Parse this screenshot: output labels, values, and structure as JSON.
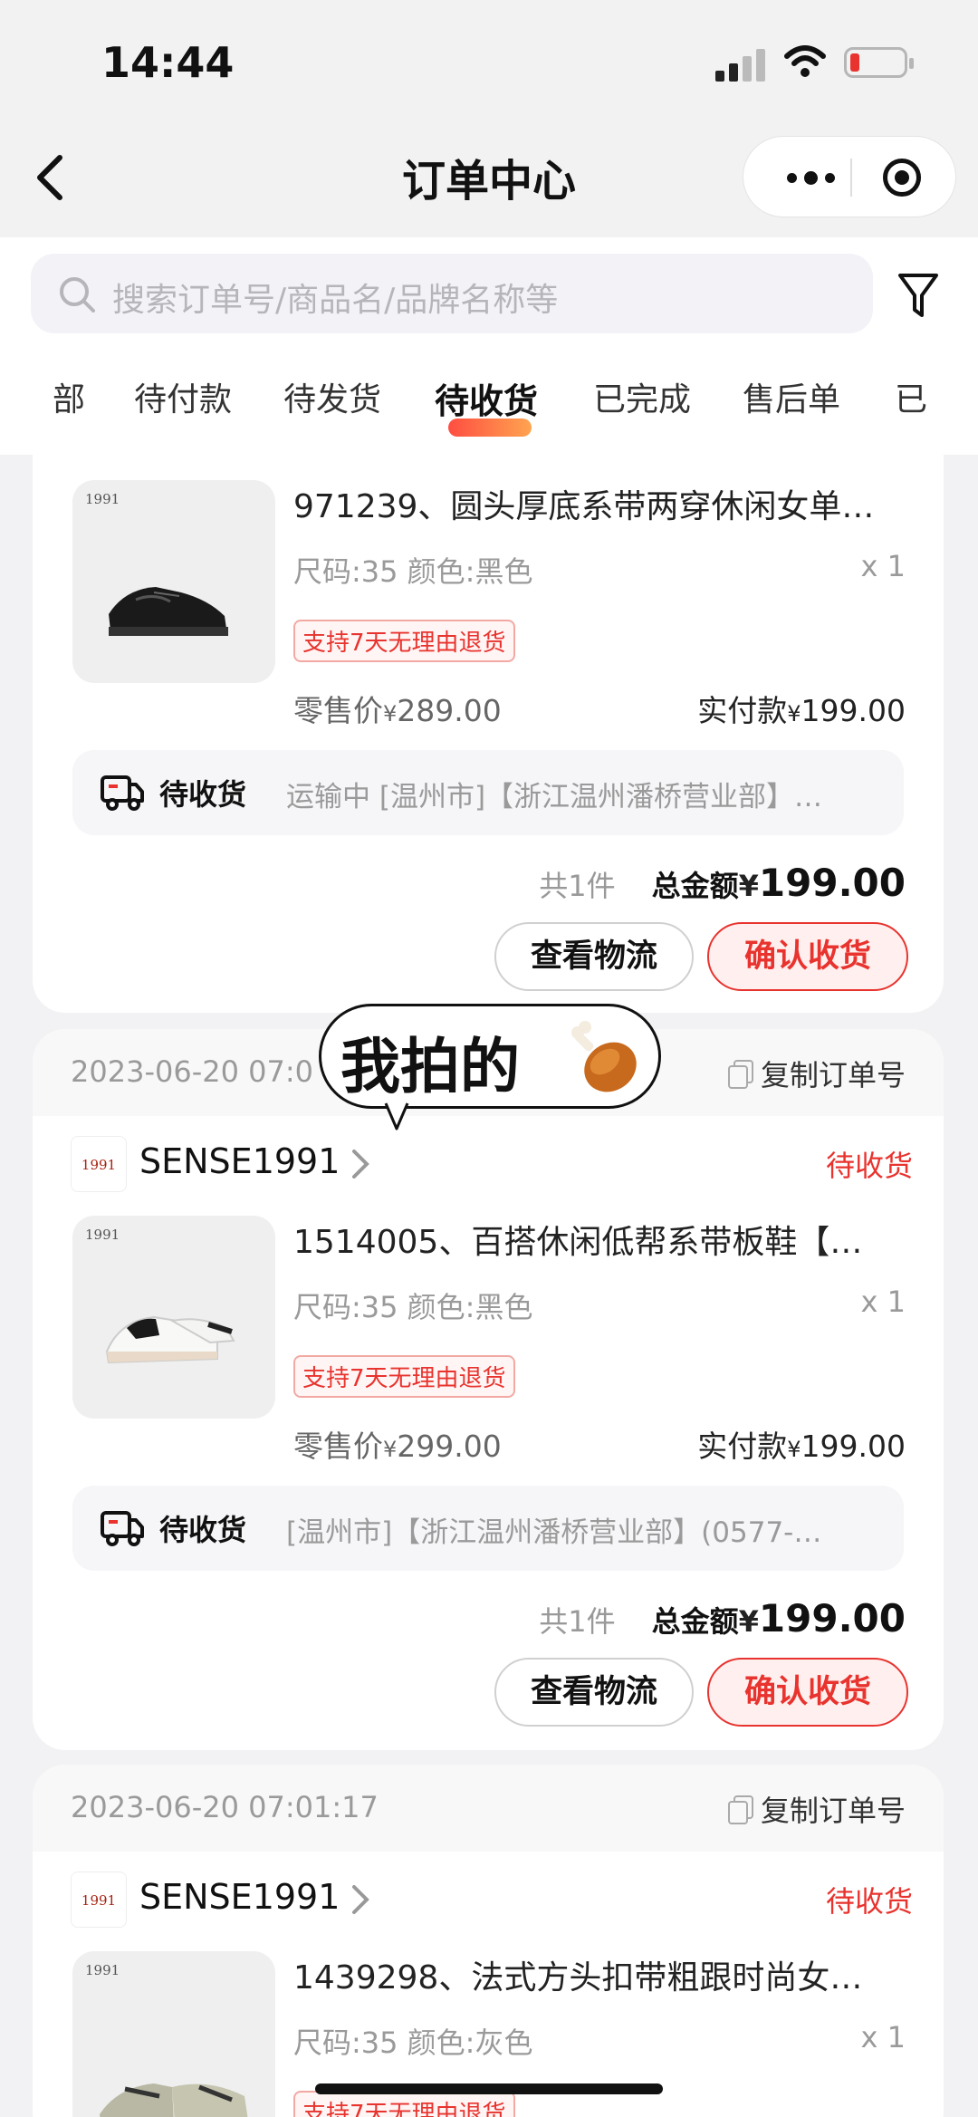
{
  "status_bar": {
    "time": "14:44"
  },
  "nav": {
    "title": "订单中心"
  },
  "search": {
    "placeholder": "搜索订单号/商品名/品牌名称等"
  },
  "tabs": [
    {
      "label": "部"
    },
    {
      "label": "待付款"
    },
    {
      "label": "待发货"
    },
    {
      "label": "待收货",
      "active": true
    },
    {
      "label": "已完成"
    },
    {
      "label": "售后单"
    },
    {
      "label": "已"
    }
  ],
  "orders": [
    {
      "product": {
        "title": "971239、圆头厚底系带两穿休闲女单…",
        "spec": "尺码:35 颜色:黑色",
        "qty": "x 1",
        "badge": "支持7天无理由退货",
        "retail_label": "零售价",
        "retail_currency": "¥",
        "retail_price": "289.00",
        "paid_label": "实付款",
        "paid_currency": "¥",
        "paid_price": "199.00"
      },
      "logistics": {
        "status": "待收货",
        "text": "运输中 [温州市]【浙江温州潘桥营业部】…"
      },
      "summary": {
        "count": "共1件",
        "label": "总金额",
        "currency": "¥",
        "amount": "199.00"
      },
      "actions": {
        "track": "查看物流",
        "confirm": "确认收货"
      }
    },
    {
      "time": "2023-06-20 07:0",
      "copy_label": "复制订单号",
      "shop": {
        "name": "SENSE1991",
        "logo_text": "1991"
      },
      "status": "待收货",
      "product": {
        "title": "1514005、百搭休闲低帮系带板鞋【…",
        "spec": "尺码:35 颜色:黑色",
        "qty": "x 1",
        "badge": "支持7天无理由退货",
        "retail_label": "零售价",
        "retail_currency": "¥",
        "retail_price": "299.00",
        "paid_label": "实付款",
        "paid_currency": "¥",
        "paid_price": "199.00"
      },
      "logistics": {
        "status": "待收货",
        "text": "[温州市]【浙江温州潘桥营业部】(0577-…"
      },
      "summary": {
        "count": "共1件",
        "label": "总金额",
        "currency": "¥",
        "amount": "199.00"
      },
      "actions": {
        "track": "查看物流",
        "confirm": "确认收货"
      }
    },
    {
      "time": "2023-06-20 07:01:17",
      "copy_label": "复制订单号",
      "shop": {
        "name": "SENSE1991",
        "logo_text": "1991"
      },
      "status": "待收货",
      "product": {
        "title": "1439298、法式方头扣带粗跟时尚女…",
        "spec": "尺码:35 颜色:灰色",
        "qty": "x 1",
        "badge": "支持7天无理由退货"
      }
    }
  ],
  "sticker": {
    "text": "我拍的"
  },
  "colors": {
    "accent": "#e8332e",
    "background": "#f2f2f4"
  },
  "icons": [
    "back-icon",
    "more-icon",
    "target-icon",
    "search-icon",
    "filter-icon",
    "copy-icon",
    "chevron-right-icon",
    "truck-icon",
    "drumstick-icon"
  ]
}
